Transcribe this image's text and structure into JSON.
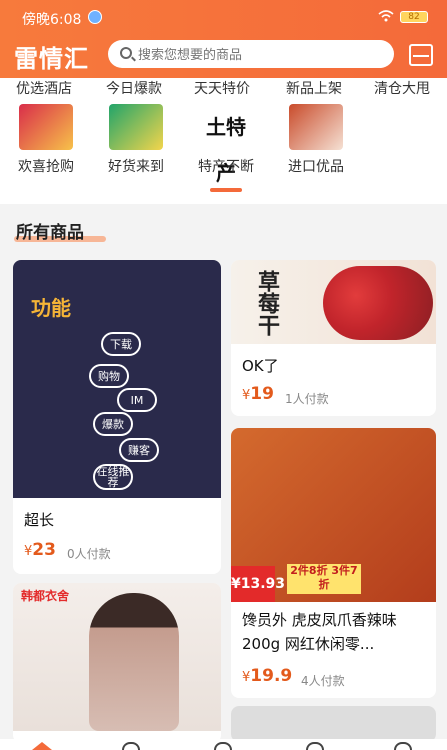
{
  "status": {
    "time": "傍晚6:08",
    "battery": "82"
  },
  "header": {
    "brand": "雷情汇",
    "search_placeholder": "搜索您想要的商品"
  },
  "top_categories": [
    "优选酒店",
    "今日爆款",
    "天天特价",
    "新品上架",
    "清仓大甩"
  ],
  "categories": [
    {
      "label": "欢喜抢购",
      "icon": "flash-sale-icon"
    },
    {
      "label": "好货来到",
      "icon": "good-goods-icon"
    },
    {
      "label": "特产不断",
      "icon": "local-specialty-icon",
      "icon_text": "土特产"
    },
    {
      "label": "进口优品",
      "icon": "imported-goods-icon"
    }
  ],
  "section": {
    "title": "所有商品"
  },
  "products": [
    {
      "title": "超长",
      "price_symbol": "¥",
      "price": "23",
      "sold": "0人付款",
      "image_caption": "功能",
      "bubbles": [
        "下载",
        "购物",
        "IM",
        "爆款",
        "赚客",
        "在线推荐"
      ]
    },
    {
      "title": "OK了",
      "price_symbol": "¥",
      "price": "19",
      "sold": "1人付款",
      "image_caption": "草莓干"
    },
    {
      "title": "馋员外 虎皮凤爪香辣味 200g 网红休闲零...",
      "price_symbol": "¥",
      "price": "19.9",
      "sold": "4人付款",
      "tag": "¥13.93",
      "promo": "2件8折 3件7折"
    },
    {
      "title": "",
      "price_symbol": "",
      "price": "",
      "sold": "",
      "brand_tag": "韩都衣舍"
    }
  ],
  "colors": {
    "accent": "#f46a3a",
    "price": "#e35a1c"
  }
}
